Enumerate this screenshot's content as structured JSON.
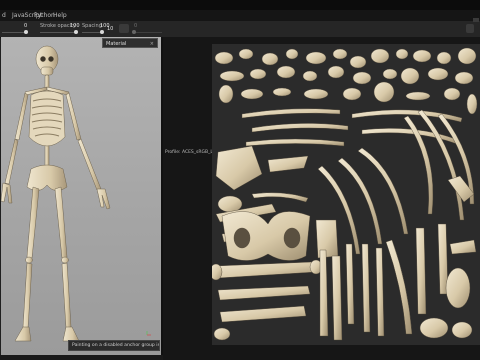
{
  "menu": {
    "items": [
      "d",
      "JavaScript",
      "Python",
      "Help"
    ]
  },
  "toolbar": {
    "size_value": "0",
    "stroke_opacity_label": "Stroke opacity",
    "stroke_opacity_value": "100",
    "spacing_label": "Spacing",
    "spacing_value": "100",
    "angle_value": "10",
    "faded_value": "0"
  },
  "panel": {
    "title": "Material"
  },
  "status": {
    "warning": "Painting on a disabled anchor group is not permitted"
  },
  "uv_view": {
    "profile_label": "Profile: ACES_sRGB_Linear"
  },
  "colors": {
    "bone": "#d8c9a8",
    "atlas_bg": "#2b2b2b",
    "viewport_bg": "#a8a8a8"
  }
}
